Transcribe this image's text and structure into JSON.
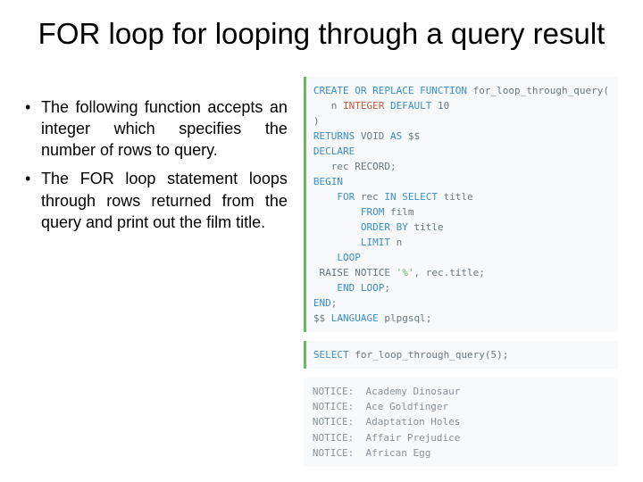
{
  "title": "FOR loop for looping through a query result",
  "bullets": [
    "The following function accepts an integer which specifies the number of rows to query.",
    "The FOR loop  statement loops through rows returned from the query and print out the film title."
  ],
  "code1": {
    "l1_kw": "CREATE OR REPLACE FUNCTION",
    "l1_rest": " for_loop_through_query(",
    "l2_pre": "   n ",
    "l2_type": "INTEGER",
    "l2_kw": " DEFAULT",
    "l2_rest": " 10",
    "l3": ")",
    "l4_kw1": "RETURNS",
    "l4_mid": " VOID ",
    "l4_kw2": "AS",
    "l4_rest": " $$",
    "l5_kw": "DECLARE",
    "l6": "   rec RECORD;",
    "l7_kw": "BEGIN",
    "l8_pre": "    ",
    "l8_kw1": "FOR",
    "l8_mid": " rec ",
    "l8_kw2": "IN SELECT",
    "l8_rest": " title",
    "l9_pre": "        ",
    "l9_kw": "FROM",
    "l9_rest": " film",
    "l10_pre": "        ",
    "l10_kw": "ORDER BY",
    "l10_rest": " title",
    "l11_pre": "        ",
    "l11_kw": "LIMIT",
    "l11_rest": " n",
    "l12_pre": "    ",
    "l12_kw": "LOOP",
    "l13_pre": " RAISE NOTICE ",
    "l13_str": "'%'",
    "l13_rest": ", rec.title;",
    "l14_pre": "    ",
    "l14_kw": "END LOOP",
    "l14_rest": ";",
    "l15_kw": "END",
    "l15_rest": ";",
    "l16_pre": "$$ ",
    "l16_kw": "LANGUAGE",
    "l16_rest": " plpgsql;"
  },
  "code2": {
    "kw": "SELECT",
    "rest": " for_loop_through_query(5);"
  },
  "output": [
    "NOTICE:  Academy Dinosaur",
    "NOTICE:  Ace Goldfinger",
    "NOTICE:  Adaptation Holes",
    "NOTICE:  Affair Prejudice",
    "NOTICE:  African Egg"
  ]
}
